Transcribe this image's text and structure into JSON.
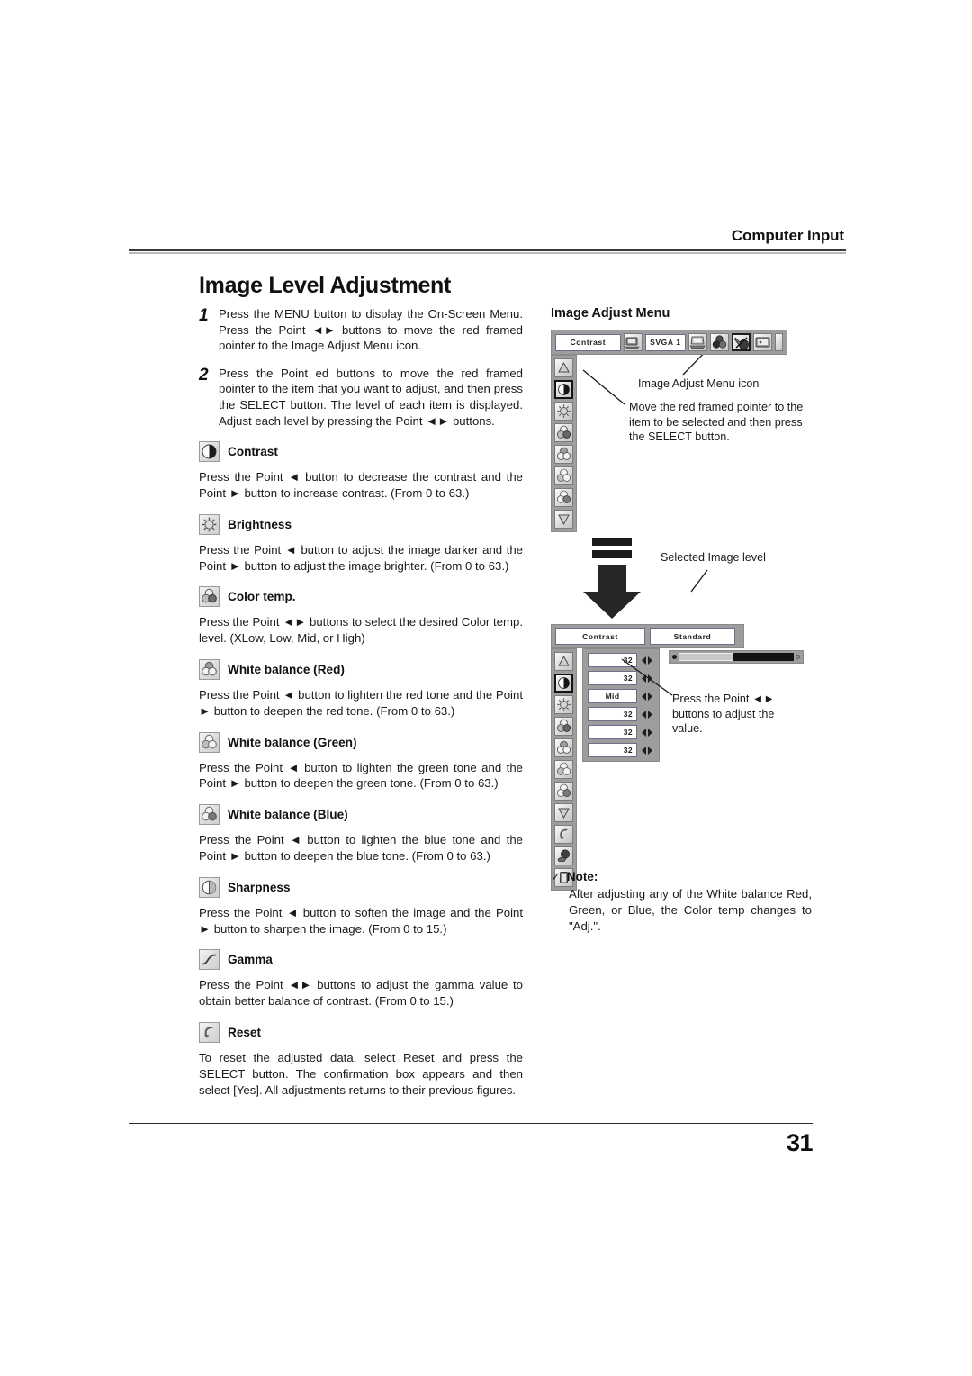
{
  "header": {
    "title": "Computer Input"
  },
  "page_title": "Image Level Adjustment",
  "page_number": "31",
  "steps": [
    {
      "num": "1",
      "text": "Press the MENU button to display the On-Screen Menu.  Press the Point ◄► buttons to move the red framed pointer to the Image Adjust Menu icon."
    },
    {
      "num": "2",
      "text": "Press the Point ed buttons to move the red framed pointer to the item that you want to adjust, and then press the SELECT button.  The level of each item is displayed.  Adjust each level by pressing the Point ◄► buttons."
    }
  ],
  "sections": [
    {
      "icon": "contrast-icon",
      "title": "Contrast",
      "text": "Press the Point ◄ button to decrease the contrast and the Point ► button to increase contrast. (From 0 to 63.)"
    },
    {
      "icon": "brightness-icon",
      "title": "Brightness",
      "text": "Press the Point ◄ button to adjust the image darker and the Point ► button to adjust the image brighter. (From 0 to 63.)"
    },
    {
      "icon": "color-temp-icon",
      "title": "Color temp.",
      "text": "Press the Point ◄► buttons to select the desired Color temp. level. (XLow, Low, Mid, or High)"
    },
    {
      "icon": "white-balance-red-icon",
      "title": "White balance (Red)",
      "text": "Press the Point ◄ button to lighten the red tone and the Point ► button to deepen the red tone. (From 0 to 63.)"
    },
    {
      "icon": "white-balance-green-icon",
      "title": "White balance (Green)",
      "text": "Press the Point ◄ button to lighten the green tone and the Point ► button to deepen the green tone. (From 0 to 63.)"
    },
    {
      "icon": "white-balance-blue-icon",
      "title": "White balance (Blue)",
      "text": "Press the Point ◄ button to lighten the blue tone and the Point ► button to deepen the blue tone. (From 0 to 63.)"
    },
    {
      "icon": "sharpness-icon",
      "title": "Sharpness",
      "text": "Press the Point ◄ button to soften the image and the Point ► button to sharpen the image. (From 0 to 15.)"
    },
    {
      "icon": "gamma-icon",
      "title": "Gamma",
      "text": "Press the Point ◄► buttons to adjust the gamma value to obtain better balance of contrast. (From 0 to 15.)"
    },
    {
      "icon": "reset-icon",
      "title": "Reset",
      "text": "To reset the adjusted data, select Reset and press the SELECT button. The confirmation box appears and then select [Yes]. All adjustments returns to their previous figures."
    }
  ],
  "diagram": {
    "title": "Image Adjust Menu",
    "top_menu": {
      "title_field": "Contrast",
      "input_field": "SVGA 1",
      "icons": [
        "computer-icon",
        "color-adjust-icon",
        "image-adjust-icon",
        "screen-icon"
      ],
      "selected_icon_index": 2
    },
    "annotations": {
      "menu_icon_label": "Image Adjust Menu icon",
      "pointer_note": "Move the red framed pointer to the item to be selected and then press the SELECT button.",
      "selected_level_label": "Selected Image level",
      "adjust_note": "Press the Point ◄► buttons to adjust the value."
    },
    "detail_menu": {
      "title_field": "Contrast",
      "level_field": "Standard",
      "rows": [
        {
          "name": "contrast",
          "value": "32"
        },
        {
          "name": "brightness",
          "value": "32"
        },
        {
          "name": "color-temp",
          "value": "Mid"
        },
        {
          "name": "white-balance-red",
          "value": "32"
        },
        {
          "name": "white-balance-green",
          "value": "32"
        },
        {
          "name": "white-balance-blue",
          "value": "32"
        }
      ],
      "slider_percent": 50
    }
  },
  "note": {
    "check": "✓",
    "title": "Note:",
    "text": "After adjusting any of the White balance Red, Green, or Blue, the Color temp changes to \"Adj.\"."
  }
}
